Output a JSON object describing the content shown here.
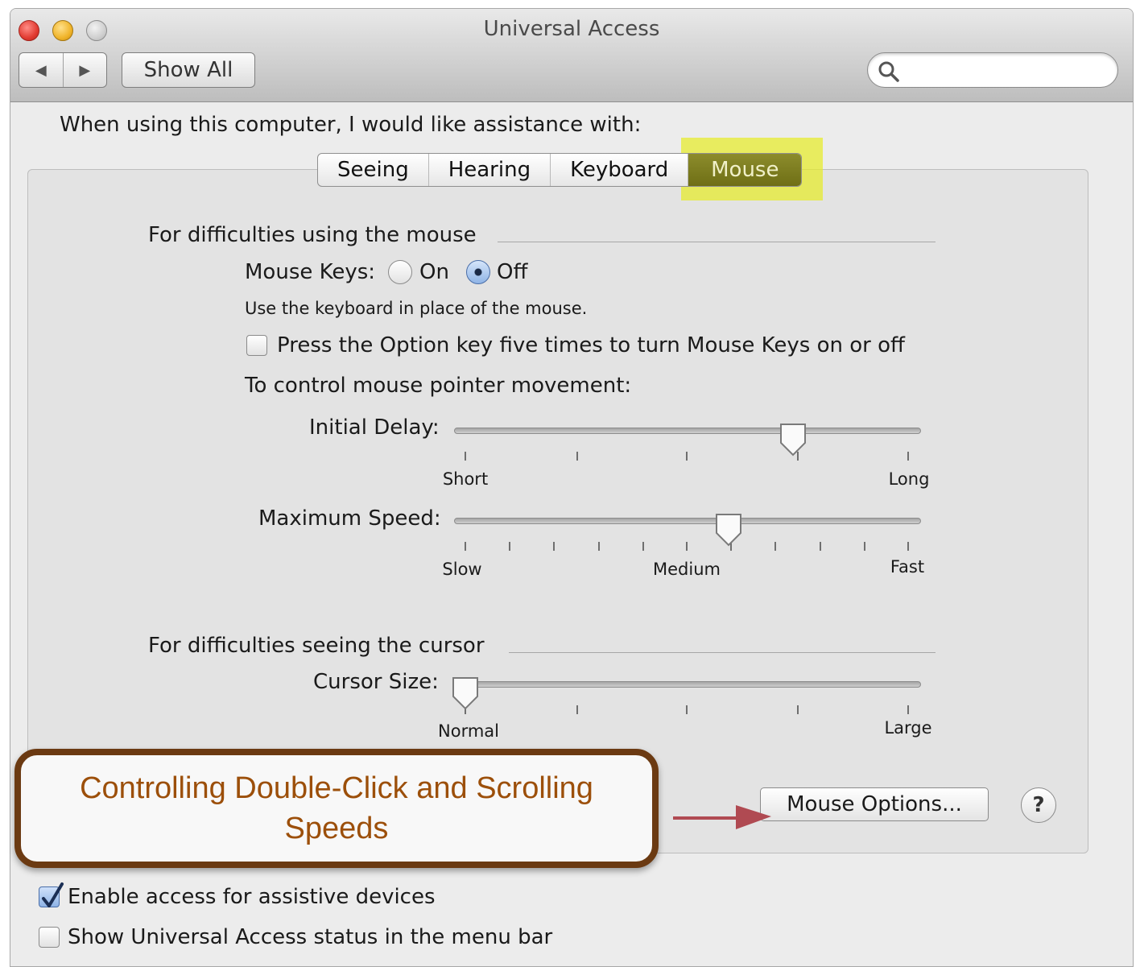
{
  "window": {
    "title": "Universal Access",
    "show_all_label": "Show All",
    "back_glyph": "◀",
    "forward_glyph": "▶"
  },
  "prompt": "When using this computer, I would like assistance with:",
  "tabs": [
    {
      "label": "Seeing",
      "selected": false
    },
    {
      "label": "Hearing",
      "selected": false
    },
    {
      "label": "Keyboard",
      "selected": false
    },
    {
      "label": "Mouse",
      "selected": true
    }
  ],
  "mouse_section": {
    "heading": "For difficulties using the mouse",
    "mouse_keys_label": "Mouse Keys:",
    "on_label": "On",
    "off_label": "Off",
    "mouse_keys_value": "Off",
    "description": "Use the keyboard in place of the mouse.",
    "option_key_checkbox_label": "Press the Option key five times to turn Mouse Keys on or off",
    "option_key_checked": false,
    "pointer_movement_label": "To control mouse pointer movement:",
    "initial_delay": {
      "label": "Initial Delay:",
      "min_label": "Short",
      "max_label": "Long",
      "value_fraction": 0.74
    },
    "maximum_speed": {
      "label": "Maximum Speed:",
      "min_label": "Slow",
      "mid_label": "Medium",
      "max_label": "Fast",
      "value_fraction": 0.595
    }
  },
  "cursor_section": {
    "heading": "For difficulties seeing the cursor",
    "cursor_size": {
      "label": "Cursor Size:",
      "min_label": "Normal",
      "max_label": "Large",
      "value_fraction": 0.0
    }
  },
  "callout": {
    "text": "Controlling Double-Click and Scrolling Speeds",
    "border_color": "#6b3a12",
    "text_color": "#9c4f0a"
  },
  "mouse_options_label": "Mouse Options...",
  "help_label": "?",
  "bottom": {
    "assistive_devices_label": "Enable access for assistive devices",
    "assistive_devices_checked": true,
    "status_menu_label": "Show Universal Access status in the menu bar",
    "status_menu_checked": false
  },
  "colors": {
    "highlight": "#e6ec28",
    "selected_tab": "#7a7a1e",
    "arrow": "#b04a52"
  }
}
